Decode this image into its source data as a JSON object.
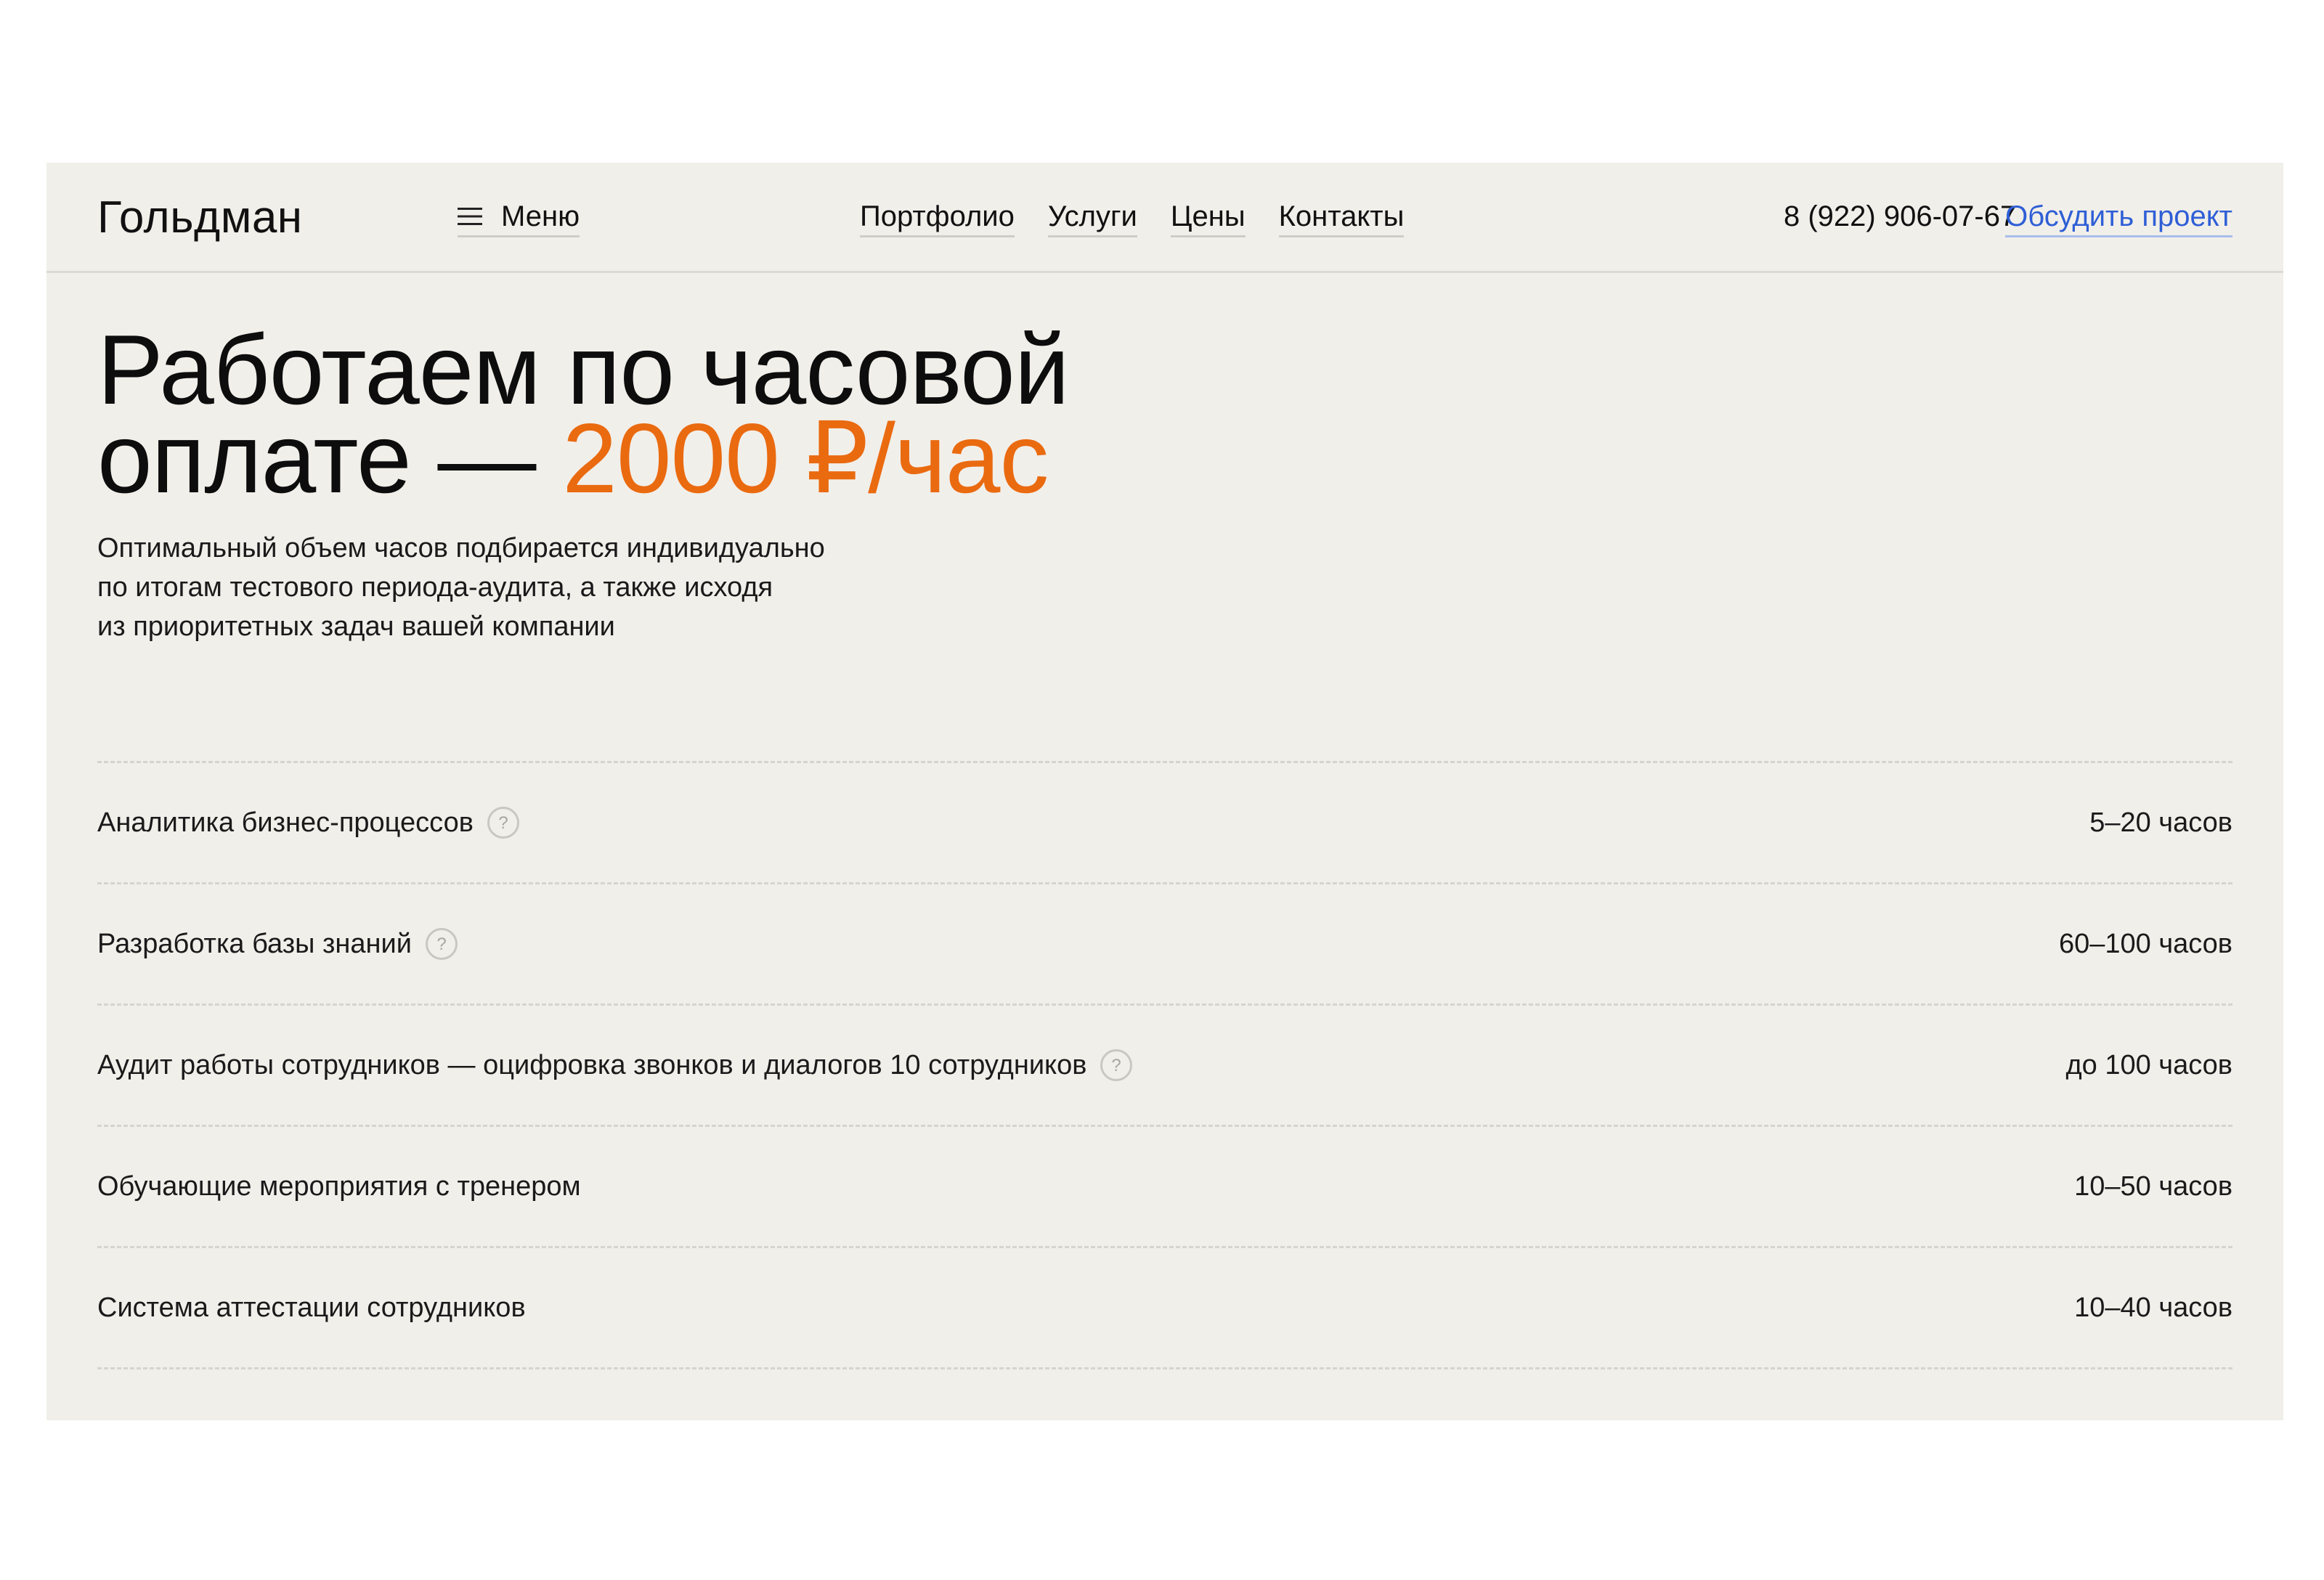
{
  "header": {
    "logo": "Гольдман",
    "menu_label": "Меню",
    "nav": [
      "Портфолио",
      "Услуги",
      "Цены",
      "Контакты"
    ],
    "phone": "8 (922) 906-07-67",
    "cta": "Обсудить проект"
  },
  "hero": {
    "title_line1": "Работаем по часовой",
    "title_line2_prefix": "оплате — ",
    "title_price": "2000 ₽/час",
    "subtitle_lines": [
      "Оптимальный объем часов подбирается индивидуально",
      "по итогам тестового периода-аудита, а также исходя",
      "из приоритетных задач вашей компании"
    ]
  },
  "services": [
    {
      "name": "Аналитика бизнес-процессов",
      "hours": "5–20 часов",
      "help": true
    },
    {
      "name": "Разработка базы знаний",
      "hours": "60–100 часов",
      "help": true
    },
    {
      "name": "Аудит работы сотрудников — оцифровка звонков и диалогов 10 сотрудников",
      "hours": "до 100 часов",
      "help": true
    },
    {
      "name": "Обучающие мероприятия с тренером",
      "hours": "10–50 часов",
      "help": false
    },
    {
      "name": "Система аттестации сотрудников",
      "hours": "10–40 часов",
      "help": false
    }
  ],
  "colors": {
    "panel_bg": "#f1efea",
    "accent": "#ea6a10",
    "link": "#2f5fd6"
  },
  "icons": {
    "menu": "hamburger-icon",
    "help": "question-circle-icon"
  }
}
